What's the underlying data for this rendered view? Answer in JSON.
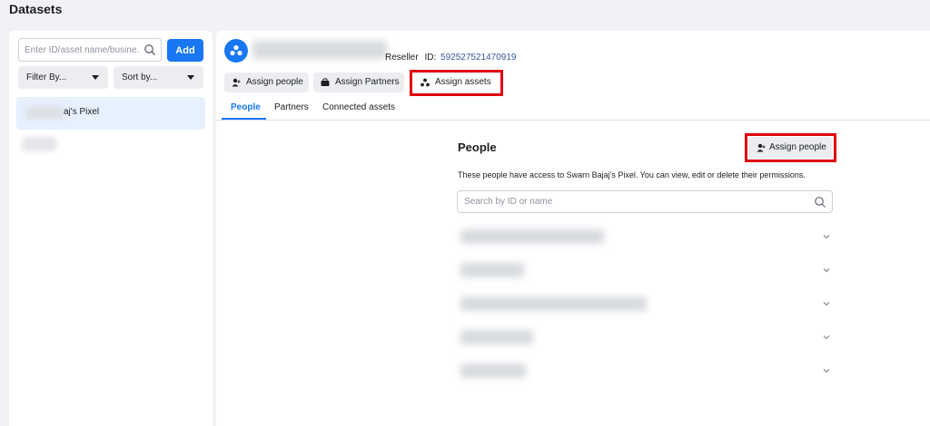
{
  "page": {
    "title": "Datasets"
  },
  "sidebar": {
    "search_placeholder": "Enter ID/asset name/busine...",
    "add_label": "Add",
    "filter_label": "Filter By...",
    "sort_label": "Sort by...",
    "selected_item_label": "aj's Pixel"
  },
  "header": {
    "reseller_label": "Reseller",
    "id_label": "ID:",
    "id_value": "592527521470919"
  },
  "toolbar": {
    "assign_people": "Assign people",
    "assign_partners": "Assign Partners",
    "assign_assets": "Assign assets"
  },
  "tabs": [
    {
      "label": "People"
    },
    {
      "label": "Partners"
    },
    {
      "label": "Connected assets"
    }
  ],
  "people_section": {
    "title": "People",
    "assign_button": "Assign people",
    "description": "These people have access to Swarn Bajaj's Pixel. You can view, edit or delete their permissions.",
    "search_placeholder": "Search by ID or name"
  },
  "colors": {
    "accent": "#1877f2",
    "highlight": "#e0000e"
  }
}
